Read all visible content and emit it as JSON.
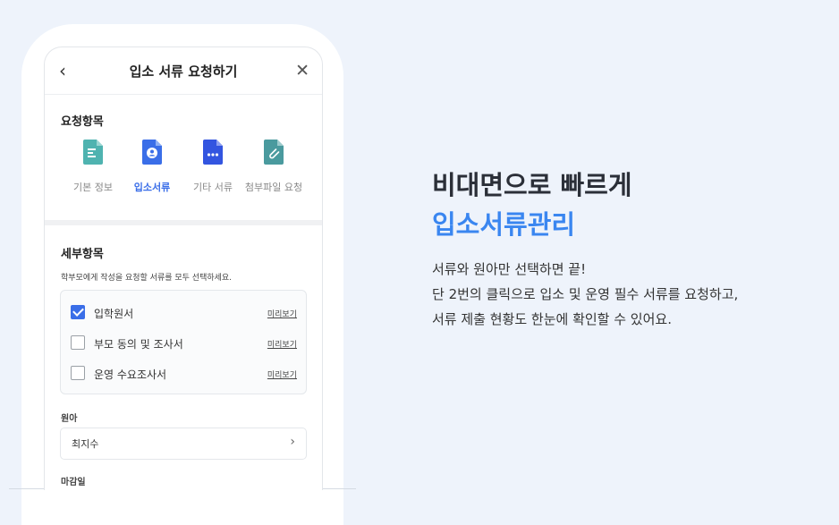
{
  "header": {
    "back_icon": "‹",
    "title": "입소 서류 요청하기",
    "close_icon": "✕"
  },
  "request_section": {
    "title": "요청항목",
    "categories": [
      {
        "label": "기본 정보",
        "icon": "document-lines-icon",
        "color": "#4fb3b0",
        "active": false
      },
      {
        "label": "입소서류",
        "icon": "profile-document-icon",
        "color": "#3a6ee8",
        "active": true
      },
      {
        "label": "기타 서류",
        "icon": "more-document-icon",
        "color": "#3355e0",
        "active": false
      },
      {
        "label": "첨부파일 요청",
        "icon": "paperclip-document-icon",
        "color": "#4a9a9e",
        "active": false
      }
    ]
  },
  "detail_section": {
    "title": "세부항목",
    "description": "학부모에게 작성을 요청할 서류를 모두 선택하세요.",
    "documents": [
      {
        "name": "입학원서",
        "checked": true,
        "preview": "미리보기"
      },
      {
        "name": "부모 동의 및 조사서",
        "checked": false,
        "preview": "미리보기"
      },
      {
        "name": "운영 수요조사서",
        "checked": false,
        "preview": "미리보기"
      }
    ]
  },
  "kindergarten": {
    "label": "원아",
    "value": "최지수",
    "chevron": "›"
  },
  "deadline": {
    "label": "마감일"
  },
  "hero": {
    "line1": "비대면으로 빠르게",
    "line2": "입소서류관리",
    "body": [
      "서류와 원아만 선택하면 끝!",
      "단 2번의 클릭으로 입소 및 운영 필수 서류를 요청하고,",
      "서류 제출 현황도 한눈에 확인할 수 있어요."
    ]
  },
  "colors": {
    "accent": "#3a6ee8",
    "hero_accent": "#3a86f0",
    "background": "#eef3fb"
  }
}
